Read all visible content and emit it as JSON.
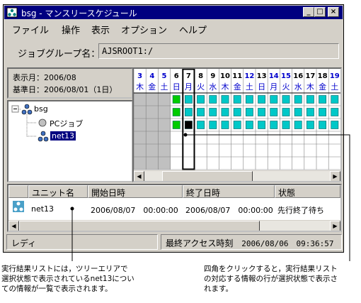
{
  "window": {
    "title": "bsg - マンスリースケジュール",
    "minimize": "_",
    "maximize": "□",
    "close": "×"
  },
  "menu": [
    "ファイル",
    "操作",
    "表示",
    "オプション",
    "ヘルプ"
  ],
  "job_group": {
    "label": "ジョブグループ名：",
    "value": "AJSROOT1:/"
  },
  "info": {
    "display_month": "表示月：2006/08",
    "base_date": "基準日：2006/08/01（1日）"
  },
  "tree": {
    "root": "bsg",
    "child1": "PCジョブ",
    "child2": "net13"
  },
  "calendar": {
    "days": [
      "3",
      "4",
      "5",
      "6",
      "7",
      "8",
      "9",
      "10",
      "11",
      "12",
      "13",
      "14",
      "15",
      "16",
      "17",
      "18",
      "19"
    ],
    "weekdays": [
      "木",
      "金",
      "土",
      "日",
      "月",
      "火",
      "水",
      "木",
      "金",
      "土",
      "日",
      "月",
      "火",
      "水",
      "木",
      "金",
      "土"
    ],
    "selected_day": "7",
    "colors": {
      "cyan": "#00c8c8",
      "green": "#00cc00",
      "grey": "#c0c0c0",
      "blue_text": "#0000cc"
    }
  },
  "list": {
    "headers": [
      "ユニット名",
      "開始日時",
      "終了日時",
      "状態"
    ],
    "row": {
      "unit": "net13",
      "start": "2006/08/07　00:00:00",
      "end": "2006/08/07　00:00:00",
      "status": "先行終了待ち"
    }
  },
  "status": {
    "ready": "レディ",
    "last_access_label": "最終アクセス時刻",
    "last_access_value": "2006/08/06　09:36:57"
  },
  "notes": {
    "left": "実行結果リストには，ツリーエリアで\n選択状態で表示されているnet13につい\nての情報が一覧で表示されます。",
    "right": "四角をクリックすると，実行結果リスト\nの対応する情報の行が選択状態で表示さ\nれます。"
  }
}
